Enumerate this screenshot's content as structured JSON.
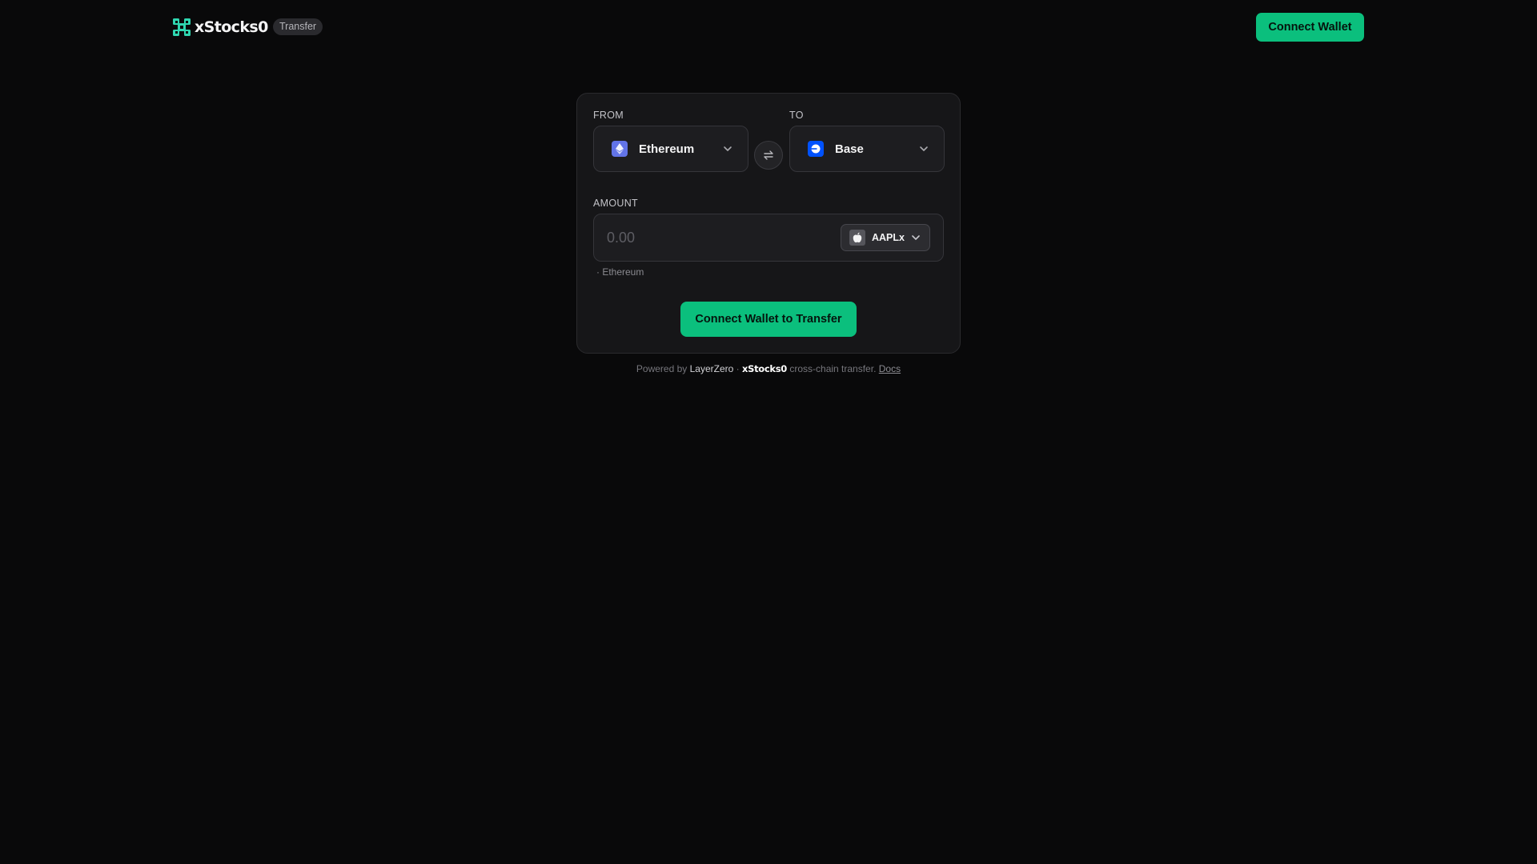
{
  "header": {
    "brand_name": "xStocks0",
    "page_badge": "Transfer",
    "connect_label": "Connect Wallet"
  },
  "transfer": {
    "from_label": "FROM",
    "to_label": "TO",
    "from_chain": "Ethereum",
    "to_chain": "Base",
    "amount_label": "AMOUNT",
    "amount_placeholder": "0.00",
    "token": "AAPLx",
    "chain_note": "· Ethereum",
    "submit_label": "Connect Wallet to Transfer"
  },
  "footer": {
    "prefix": "Powered by",
    "provider": "LayerZero",
    "separator": "·",
    "brand": "xStocks0",
    "suffix": "cross-chain transfer.",
    "docs_label": "Docs"
  },
  "colors": {
    "background": "#09090a",
    "card": "#161618",
    "accent": "#0bbf7d",
    "ethereum": "#6274e8",
    "base": "#0052ff",
    "brand_mark": "#2fd6b0"
  },
  "icons": {
    "logo": "xstocks-logo-icon",
    "from_chain": "ethereum-icon",
    "to_chain": "base-icon",
    "swap": "swap-arrows-icon",
    "token": "apple-icon",
    "dropdown": "chevron-down-icon"
  }
}
